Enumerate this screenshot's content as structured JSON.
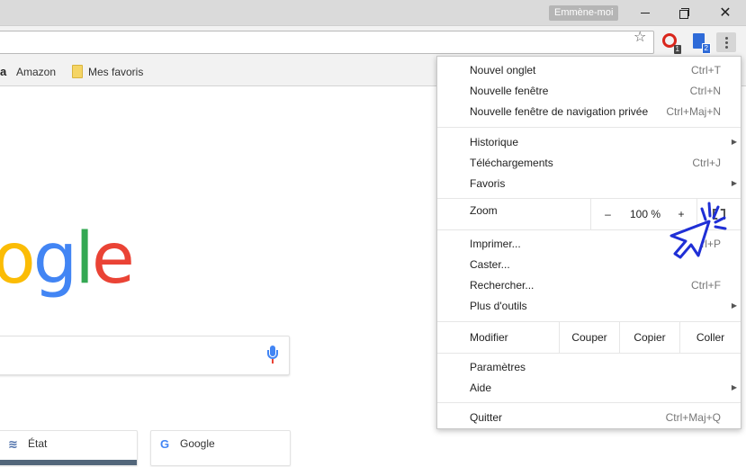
{
  "titlebar": {
    "profile_label": "Emmène-moi",
    "icons": [
      "minimize-icon",
      "restore-icon",
      "close-icon"
    ]
  },
  "toolbar": {
    "icons": [
      "bookmark-star-icon",
      "extension-red-icon",
      "extension-doc-icon",
      "menu-dots-icon"
    ],
    "ext1_badge": "1",
    "ext2_badge": "2"
  },
  "bookmarks": [
    {
      "label": "Amazon",
      "icon": "amazon-icon"
    },
    {
      "label": "Mes favoris",
      "icon": "folder-icon"
    }
  ],
  "page": {
    "logo_text": [
      "o",
      "g",
      "l",
      "e"
    ],
    "tiles": [
      {
        "label": "État",
        "icon": "tile-site-icon"
      },
      {
        "label": "Google",
        "icon": "google-g-icon"
      }
    ],
    "tile2_icon_glyph": "G"
  },
  "menu": {
    "items": {
      "new_tab": {
        "label": "Nouvel onglet",
        "shortcut": "Ctrl+T"
      },
      "new_window": {
        "label": "Nouvelle fenêtre",
        "shortcut": "Ctrl+N"
      },
      "incognito": {
        "label": "Nouvelle fenêtre de navigation privée",
        "shortcut": "Ctrl+Maj+N"
      },
      "history": {
        "label": "Historique"
      },
      "downloads": {
        "label": "Téléchargements",
        "shortcut": "Ctrl+J"
      },
      "bookmarks": {
        "label": "Favoris"
      },
      "print": {
        "label": "Imprimer...",
        "shortcut": "Ctrl+P"
      },
      "cast": {
        "label": "Caster..."
      },
      "find": {
        "label": "Rechercher...",
        "shortcut": "Ctrl+F"
      },
      "more_tools": {
        "label": "Plus d'outils"
      },
      "settings": {
        "label": "Paramètres"
      },
      "help": {
        "label": "Aide"
      },
      "quit": {
        "label": "Quitter",
        "shortcut": "Ctrl+Maj+Q"
      }
    },
    "zoom": {
      "label": "Zoom",
      "minus": "–",
      "value": "100 %",
      "plus": "+"
    },
    "edit": {
      "label": "Modifier",
      "cut": "Couper",
      "copy": "Copier",
      "paste": "Coller"
    },
    "submenu_arrow": "▶"
  },
  "colors": {
    "google_blue": "#4285f4",
    "google_red": "#ea4335",
    "google_yellow": "#fbbc05",
    "google_green": "#34a853",
    "cursor_blue": "#1f2fd6"
  }
}
